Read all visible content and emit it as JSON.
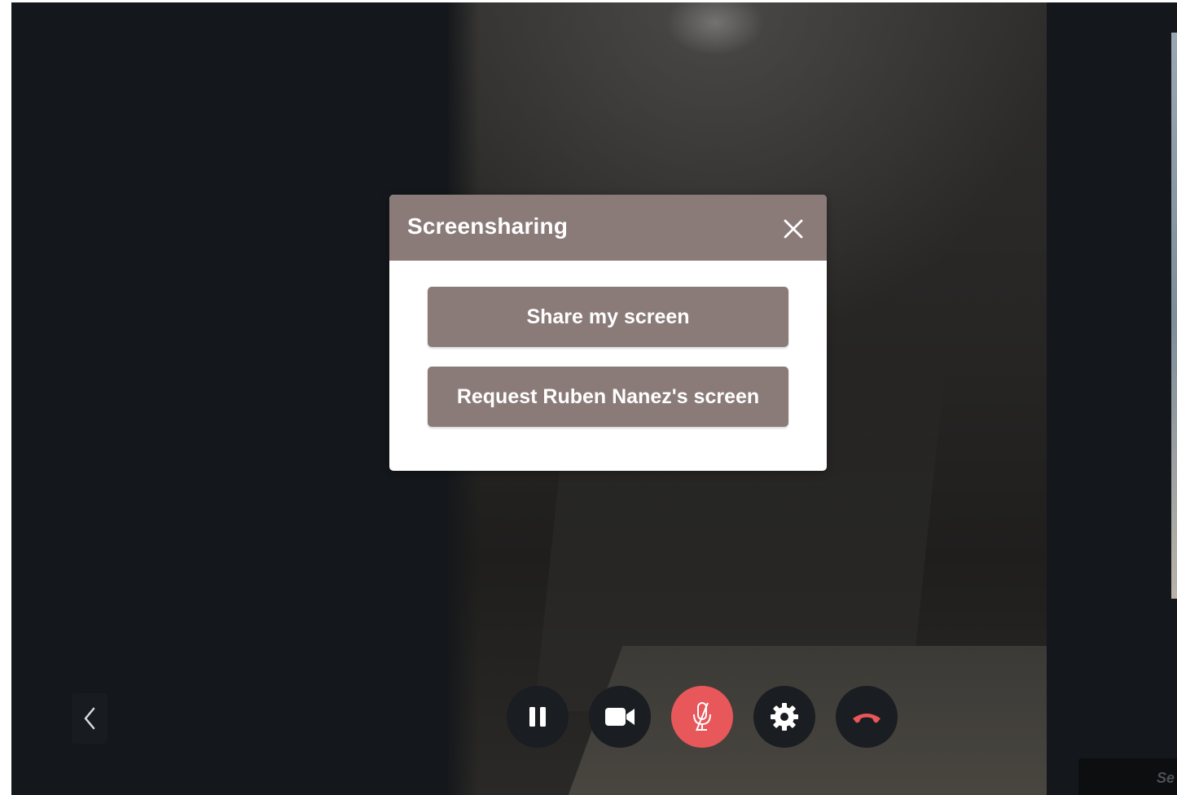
{
  "modal": {
    "title": "Screensharing",
    "share_button": "Share my screen",
    "request_button": "Request Ruben Nanez's screen"
  },
  "toolbar": {
    "buttons": [
      {
        "icon": "pause-icon"
      },
      {
        "icon": "video-camera-icon"
      },
      {
        "icon": "microphone-muted-icon",
        "state": "muted"
      },
      {
        "icon": "gear-icon"
      },
      {
        "icon": "hang-up-icon"
      }
    ]
  },
  "sidebar_panel": {
    "label": "Se"
  },
  "colors": {
    "accent": "#8a7b79",
    "mute": "#e8575a",
    "hangup": "#e8575a",
    "background": "#14171b"
  }
}
